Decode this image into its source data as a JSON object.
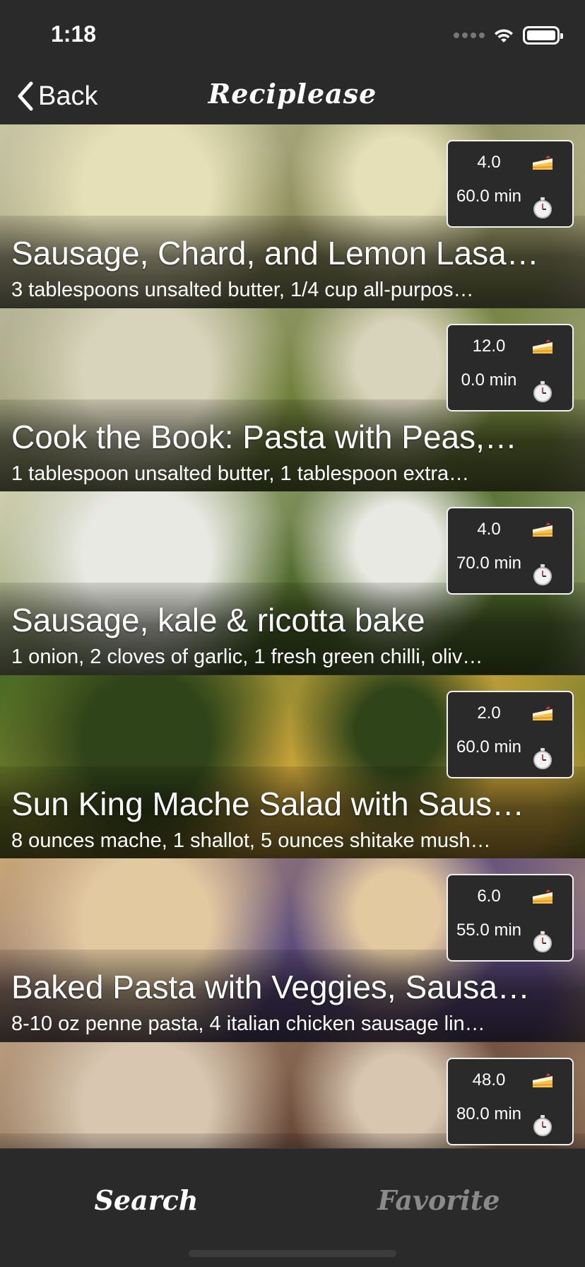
{
  "status_bar": {
    "time": "1:18"
  },
  "nav": {
    "back_label": "Back",
    "title": "Reciplease"
  },
  "recipes": [
    {
      "title": "Sausage, Chard, and Lemon Lasa…",
      "ingredients": "3 tablespoons unsalted butter, 1/4 cup all-purpos…",
      "yield": "4.0",
      "time": "60.0 min",
      "bg_colors": [
        "#c9c5a5",
        "#8f8f5f",
        "#e6e0b8"
      ]
    },
    {
      "title": "Cook the Book: Pasta with Peas,…",
      "ingredients": "1 tablespoon unsalted butter, 1 tablespoon extra…",
      "yield": "12.0",
      "time": "0.0 min",
      "bg_colors": [
        "#b8b59a",
        "#6f7f3a",
        "#d8d4bc"
      ]
    },
    {
      "title": "Sausage, kale & ricotta bake",
      "ingredients": "1 onion, 2 cloves of garlic, 1 fresh green chilli, oliv…",
      "yield": "4.0",
      "time": "70.0 min",
      "bg_colors": [
        "#cfcfb0",
        "#4f6a2a",
        "#e9e9e3"
      ]
    },
    {
      "title": "Sun King Mache Salad with Saus…",
      "ingredients": "8 ounces mache, 1 shallot, 5 ounces shitake mush…",
      "yield": "2.0",
      "time": "60.0 min",
      "bg_colors": [
        "#4a6a24",
        "#c8a23a",
        "#2f4419"
      ]
    },
    {
      "title": "Baked Pasta with Veggies, Sausa…",
      "ingredients": "8-10 oz penne pasta, 4 italian chicken sausage lin…",
      "yield": "6.0",
      "time": "55.0 min",
      "bg_colors": [
        "#c9a677",
        "#5c4b7d",
        "#e3c9a0"
      ]
    },
    {
      "title": "",
      "ingredients": "",
      "yield": "48.0",
      "time": "80.0 min",
      "bg_colors": [
        "#b79c7c",
        "#6a4a3a",
        "#d8c6b0"
      ]
    }
  ],
  "tabs": {
    "search": "Search",
    "favorite": "Favorite"
  },
  "colors": {
    "background": "#2b2a2b",
    "active_tab": "#ffffff",
    "inactive_tab": "#8a8a8a"
  }
}
